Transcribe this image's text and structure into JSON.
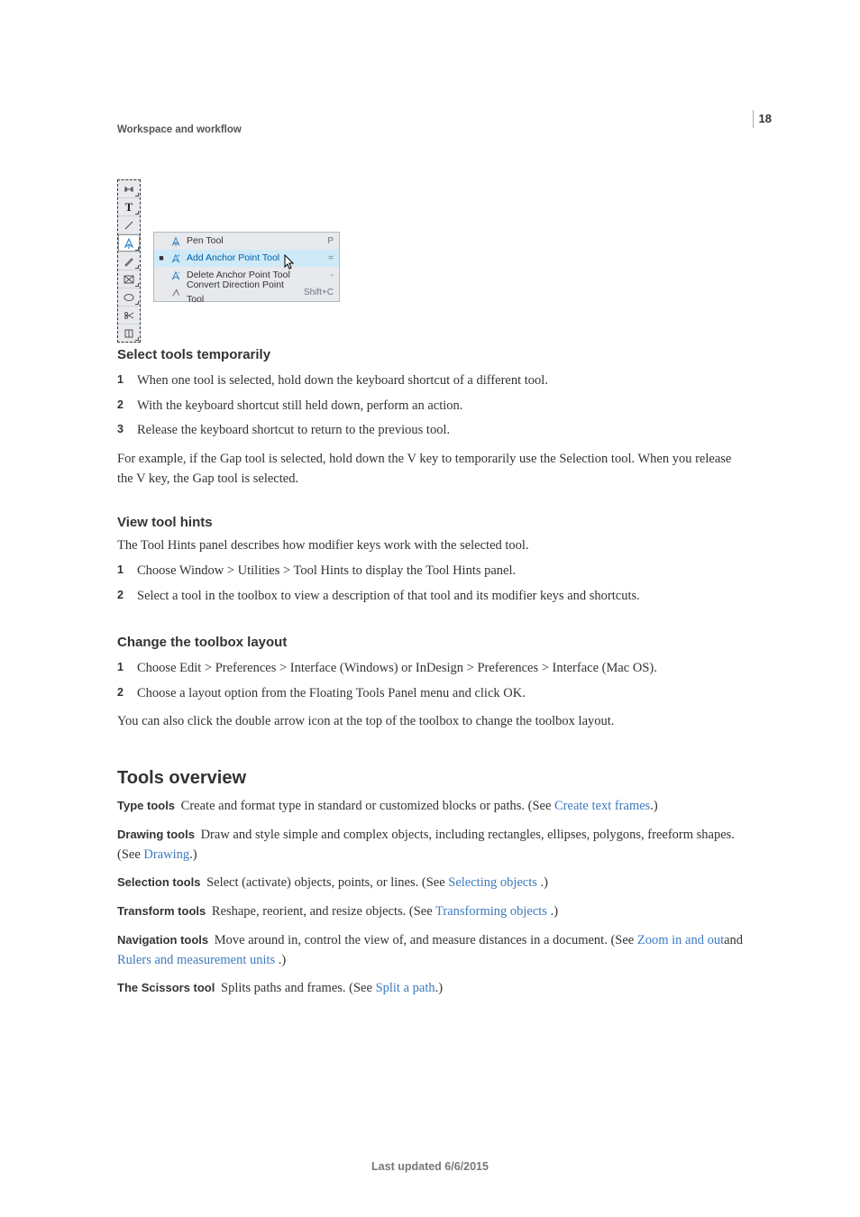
{
  "page_number": "18",
  "running_header": "Workspace and workflow",
  "figure": {
    "flyout": [
      {
        "bullet": "",
        "icon": "pen",
        "label": "Pen Tool",
        "shortcut": "P",
        "selected": false
      },
      {
        "bullet": "■",
        "icon": "add-anchor",
        "label": "Add Anchor Point Tool",
        "shortcut": "=",
        "selected": true
      },
      {
        "bullet": "",
        "icon": "delete-anchor",
        "label": "Delete Anchor Point Tool",
        "shortcut": "-",
        "selected": false
      },
      {
        "bullet": "",
        "icon": "convert-point",
        "label": "Convert Direction Point Tool",
        "shortcut": "Shift+C",
        "selected": false
      }
    ]
  },
  "sections": {
    "select_tools": {
      "heading": "Select tools temporarily",
      "steps": [
        "When one tool is selected, hold down the keyboard shortcut of a different tool.",
        "With the keyboard shortcut still held down, perform an action.",
        "Release the keyboard shortcut to return to the previous tool."
      ],
      "after": "For example, if the Gap tool is selected, hold down the V key to temporarily use the Selection tool. When you release the V key, the Gap tool is selected."
    },
    "view_hints": {
      "heading": "View tool hints",
      "intro": "The Tool Hints panel describes how modifier keys work with the selected tool.",
      "steps": [
        "Choose Window > Utilities > Tool Hints to display the Tool Hints panel.",
        "Select a tool in the toolbox to view a description of that tool and its modifier keys and shortcuts."
      ]
    },
    "change_layout": {
      "heading": "Change the toolbox layout",
      "steps": [
        "Choose Edit > Preferences > Interface (Windows) or InDesign > Preferences > Interface (Mac OS).",
        "Choose a layout option from the Floating Tools Panel menu and click OK."
      ],
      "after": "You can also click the double arrow icon at the top of the toolbox to change the toolbox layout."
    }
  },
  "tools_overview": {
    "heading": "Tools overview",
    "items": [
      {
        "term": "Type tools",
        "pre": "Create and format type in standard or customized blocks or paths. (See ",
        "link": "Create text frames",
        "post": ".)"
      },
      {
        "term": "Drawing tools",
        "pre": "Draw and style simple and complex objects, including rectangles, ellipses, polygons, freeform shapes. (See ",
        "link": "Drawing",
        "post": ".)"
      },
      {
        "term": "Selection tools",
        "pre": "Select (activate) objects, points, or lines. (See ",
        "link": "Selecting objects ",
        "post": ".)"
      },
      {
        "term": "Transform tools",
        "pre": "Reshape, reorient, and resize objects. (See ",
        "link": "Transforming objects ",
        "post": ".)"
      },
      {
        "term": "Navigation tools",
        "pre": "Move around in, control the view of, and measure distances in a document. (See ",
        "link": "Zoom in and out",
        "post": "and "
      },
      {
        "term": "The Scissors tool",
        "pre": "Splits paths and frames. (See ",
        "link": "Split a path",
        "post": ".)"
      }
    ],
    "nav_extra_link": "Rulers and measurement units ",
    "nav_extra_post": ".)"
  },
  "footer": "Last updated 6/6/2015"
}
